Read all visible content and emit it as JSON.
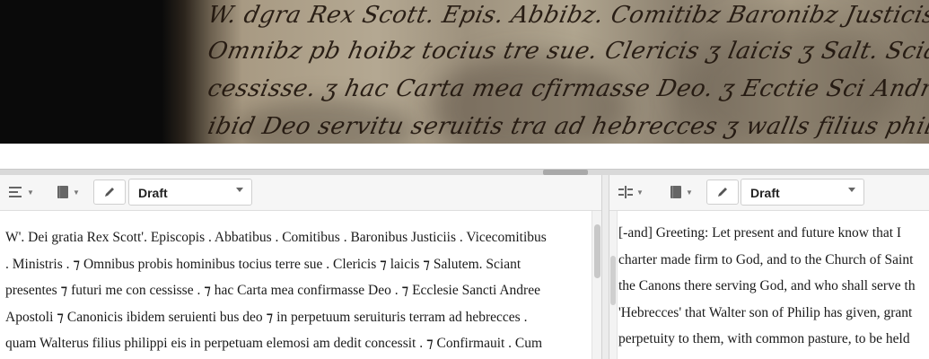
{
  "manuscript": {
    "lines": [
      "W. dgra Rex Scott. Epis. Abbibz. Comitibz Baronibz Justicis. Vicecomiti",
      "Omnibz pb hoibz tocius tre sue. Clericis ʒ laicis ʒ Salt. Sciant psentes",
      "cessisse. ʒ hac Carta mea cfirmasse Deo. ʒ Ecctie Sci Andree Aptli ʒ Cano",
      "ibid Deo servitu seruitis tra ad hebrecces ʒ walls filius philippi et"
    ]
  },
  "left_panel": {
    "status": "Draft",
    "lines": [
      "W'. Dei gratia Rex Scott'. Episcopis . Abbatibus . Comitibus . Baronibus Justiciis . Vicecomitibus",
      ". Ministris . ⁊   Omnibus probis hominibus tocius terre sue . Clericis ⁊ laicis ⁊ Salutem. Sciant",
      "presentes ⁊ futuri me con cessisse . ⁊ hac Carta mea confirmasse Deo . ⁊ Ecclesie Sancti Andree",
      "Apostoli ⁊ Canonicis ibidem seruienti bus deo ⁊ in perpetuum seruituris terram ad hebrecces .",
      "quam Walterus filius philippi eis in perpetuam elemosi am dedit concessit . ⁊ Confirmauit . Cum"
    ]
  },
  "right_panel": {
    "status": "Draft",
    "lines": [
      "[-and] Greeting:  Let present and future know that I",
      "charter made firm to God, and to the Church of Saint",
      "the Canons there serving God, and who shall serve th",
      "'Hebrecces' that Walter son of Philip has given, grant",
      "perpetuity to them, with common pasture, to be held"
    ]
  },
  "icons": {
    "align": "align-left-icon",
    "book": "book-icon",
    "pen": "pencil-icon",
    "vertical_align": "vertical-align-icon"
  }
}
